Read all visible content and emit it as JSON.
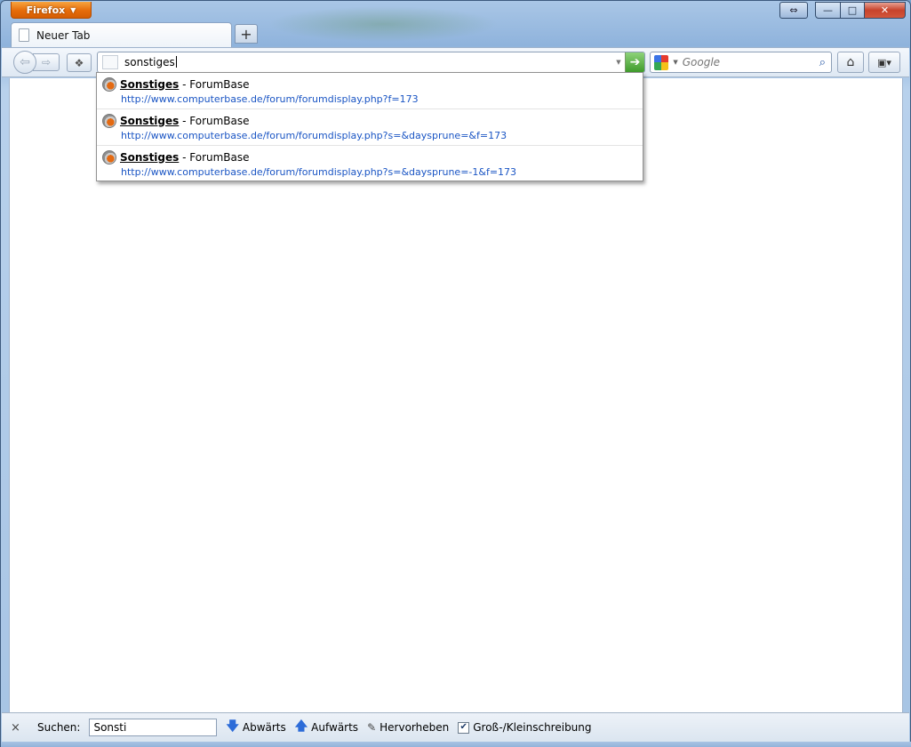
{
  "window": {
    "app_button_label": "Firefox",
    "fullscreen_glyph": "⇔",
    "minimize_glyph": "—",
    "maximize_glyph": "□",
    "close_glyph": "✕"
  },
  "tabs": [
    {
      "label": "Neuer Tab",
      "icon": "page-icon",
      "selected": true
    }
  ],
  "new_tab_glyph": "+",
  "navbar": {
    "back_glyph": "⇦",
    "forward_glyph": "⇨",
    "url_value": "sonstiges",
    "go_glyph": "➔",
    "search_engine_icon": "google-icon",
    "search_placeholder": "Google",
    "search_go_glyph": "⌕",
    "home_glyph": "⌂",
    "bookmarks_glyph": "▣▾"
  },
  "autocomplete": [
    {
      "title_bold": "Sonstiges",
      "title_rest": " - ForumBase",
      "url": "http://www.computerbase.de/forum/forumdisplay.php?f=173"
    },
    {
      "title_bold": "Sonstiges",
      "title_rest": " - ForumBase",
      "url": "http://www.computerbase.de/forum/forumdisplay.php?s=&daysprune=&f=173"
    },
    {
      "title_bold": "Sonstiges",
      "title_rest": " - ForumBase",
      "url": "http://www.computerbase.de/forum/forumdisplay.php?s=&daysprune=-1&f=173"
    }
  ],
  "findbar": {
    "close_glyph": "×",
    "label": "Suchen:",
    "input_value": "Sonsti",
    "next_label": "Abwärts",
    "prev_label": "Aufwärts",
    "highlight_label": "Hervorheben",
    "match_case_label": "Groß-/Kleinschreibung",
    "match_case_checked": true
  },
  "colors": {
    "app_button": "#e66c0a",
    "link_blue": "#1a55c4",
    "go_green": "#3f9b2b"
  }
}
